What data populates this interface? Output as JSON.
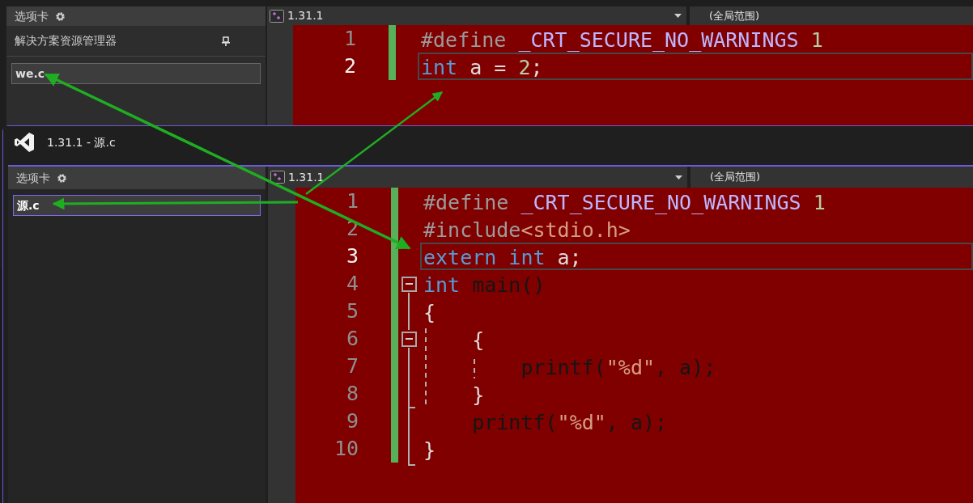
{
  "windows": [
    {
      "active": false,
      "sidebar": {
        "tab": "选项卡",
        "panel_title": "解决方案资源管理器",
        "files": [
          {
            "name": "we.c",
            "selected": true
          }
        ]
      },
      "editor": {
        "project": "1.31.1",
        "scope": "(全局范围)",
        "lines": [
          {
            "number": "1",
            "current": false,
            "tokens": [
              {
                "kind": "preproc",
                "text": "#define "
              },
              {
                "kind": "macro",
                "text": "_CRT_SECURE_NO_WARNINGS "
              },
              {
                "kind": "number",
                "text": "1"
              }
            ]
          },
          {
            "number": "2",
            "current": true,
            "tokens": [
              {
                "kind": "keyword",
                "text": "int"
              },
              {
                "kind": "plain",
                "text": " a = "
              },
              {
                "kind": "number",
                "text": "2"
              },
              {
                "kind": "plain",
                "text": ";"
              }
            ]
          }
        ]
      }
    },
    {
      "active": true,
      "title": "1.31.1 - 源.c",
      "sidebar": {
        "tab": "选项卡",
        "files": [
          {
            "name": "源.c",
            "selected": true
          }
        ]
      },
      "editor": {
        "project": "1.31.1",
        "scope": "(全局范围)",
        "lines": [
          {
            "number": "1",
            "current": false,
            "tokens": [
              {
                "kind": "preproc",
                "text": "#define "
              },
              {
                "kind": "macro",
                "text": "_CRT_SECURE_NO_WARNINGS "
              },
              {
                "kind": "number",
                "text": "1"
              }
            ]
          },
          {
            "number": "2",
            "current": false,
            "tokens": [
              {
                "kind": "preproc",
                "text": "#include"
              },
              {
                "kind": "string",
                "text": "<stdio.h>"
              }
            ]
          },
          {
            "number": "3",
            "current": true,
            "tokens": [
              {
                "kind": "keyword",
                "text": "extern "
              },
              {
                "kind": "keyword",
                "text": "int"
              },
              {
                "kind": "plain",
                "text": " a;"
              }
            ]
          },
          {
            "number": "4",
            "current": false,
            "fold": {
              "expanded": true
            },
            "tokens": [
              {
                "kind": "keyword",
                "text": "int "
              },
              {
                "kind": "function",
                "text": "main()"
              }
            ]
          },
          {
            "number": "5",
            "current": false,
            "tokens": [
              {
                "kind": "plain",
                "text": "{"
              }
            ]
          },
          {
            "number": "6",
            "current": false,
            "fold": {
              "expanded": true
            },
            "tokens": [
              {
                "kind": "plain",
                "text": "    {"
              }
            ]
          },
          {
            "number": "7",
            "current": false,
            "tokens": [
              {
                "kind": "function",
                "text": "        printf("
              },
              {
                "kind": "string",
                "text": "\"%d\""
              },
              {
                "kind": "function",
                "text": ", a);"
              }
            ]
          },
          {
            "number": "8",
            "current": false,
            "tokens": [
              {
                "kind": "plain",
                "text": "    }"
              }
            ]
          },
          {
            "number": "9",
            "current": false,
            "tokens": [
              {
                "kind": "function",
                "text": "    printf("
              },
              {
                "kind": "string",
                "text": "\"%d\""
              },
              {
                "kind": "function",
                "text": ", a);"
              }
            ]
          },
          {
            "number": "10",
            "current": false,
            "tokens": [
              {
                "kind": "plain",
                "text": "}"
              }
            ]
          }
        ]
      }
    }
  ]
}
